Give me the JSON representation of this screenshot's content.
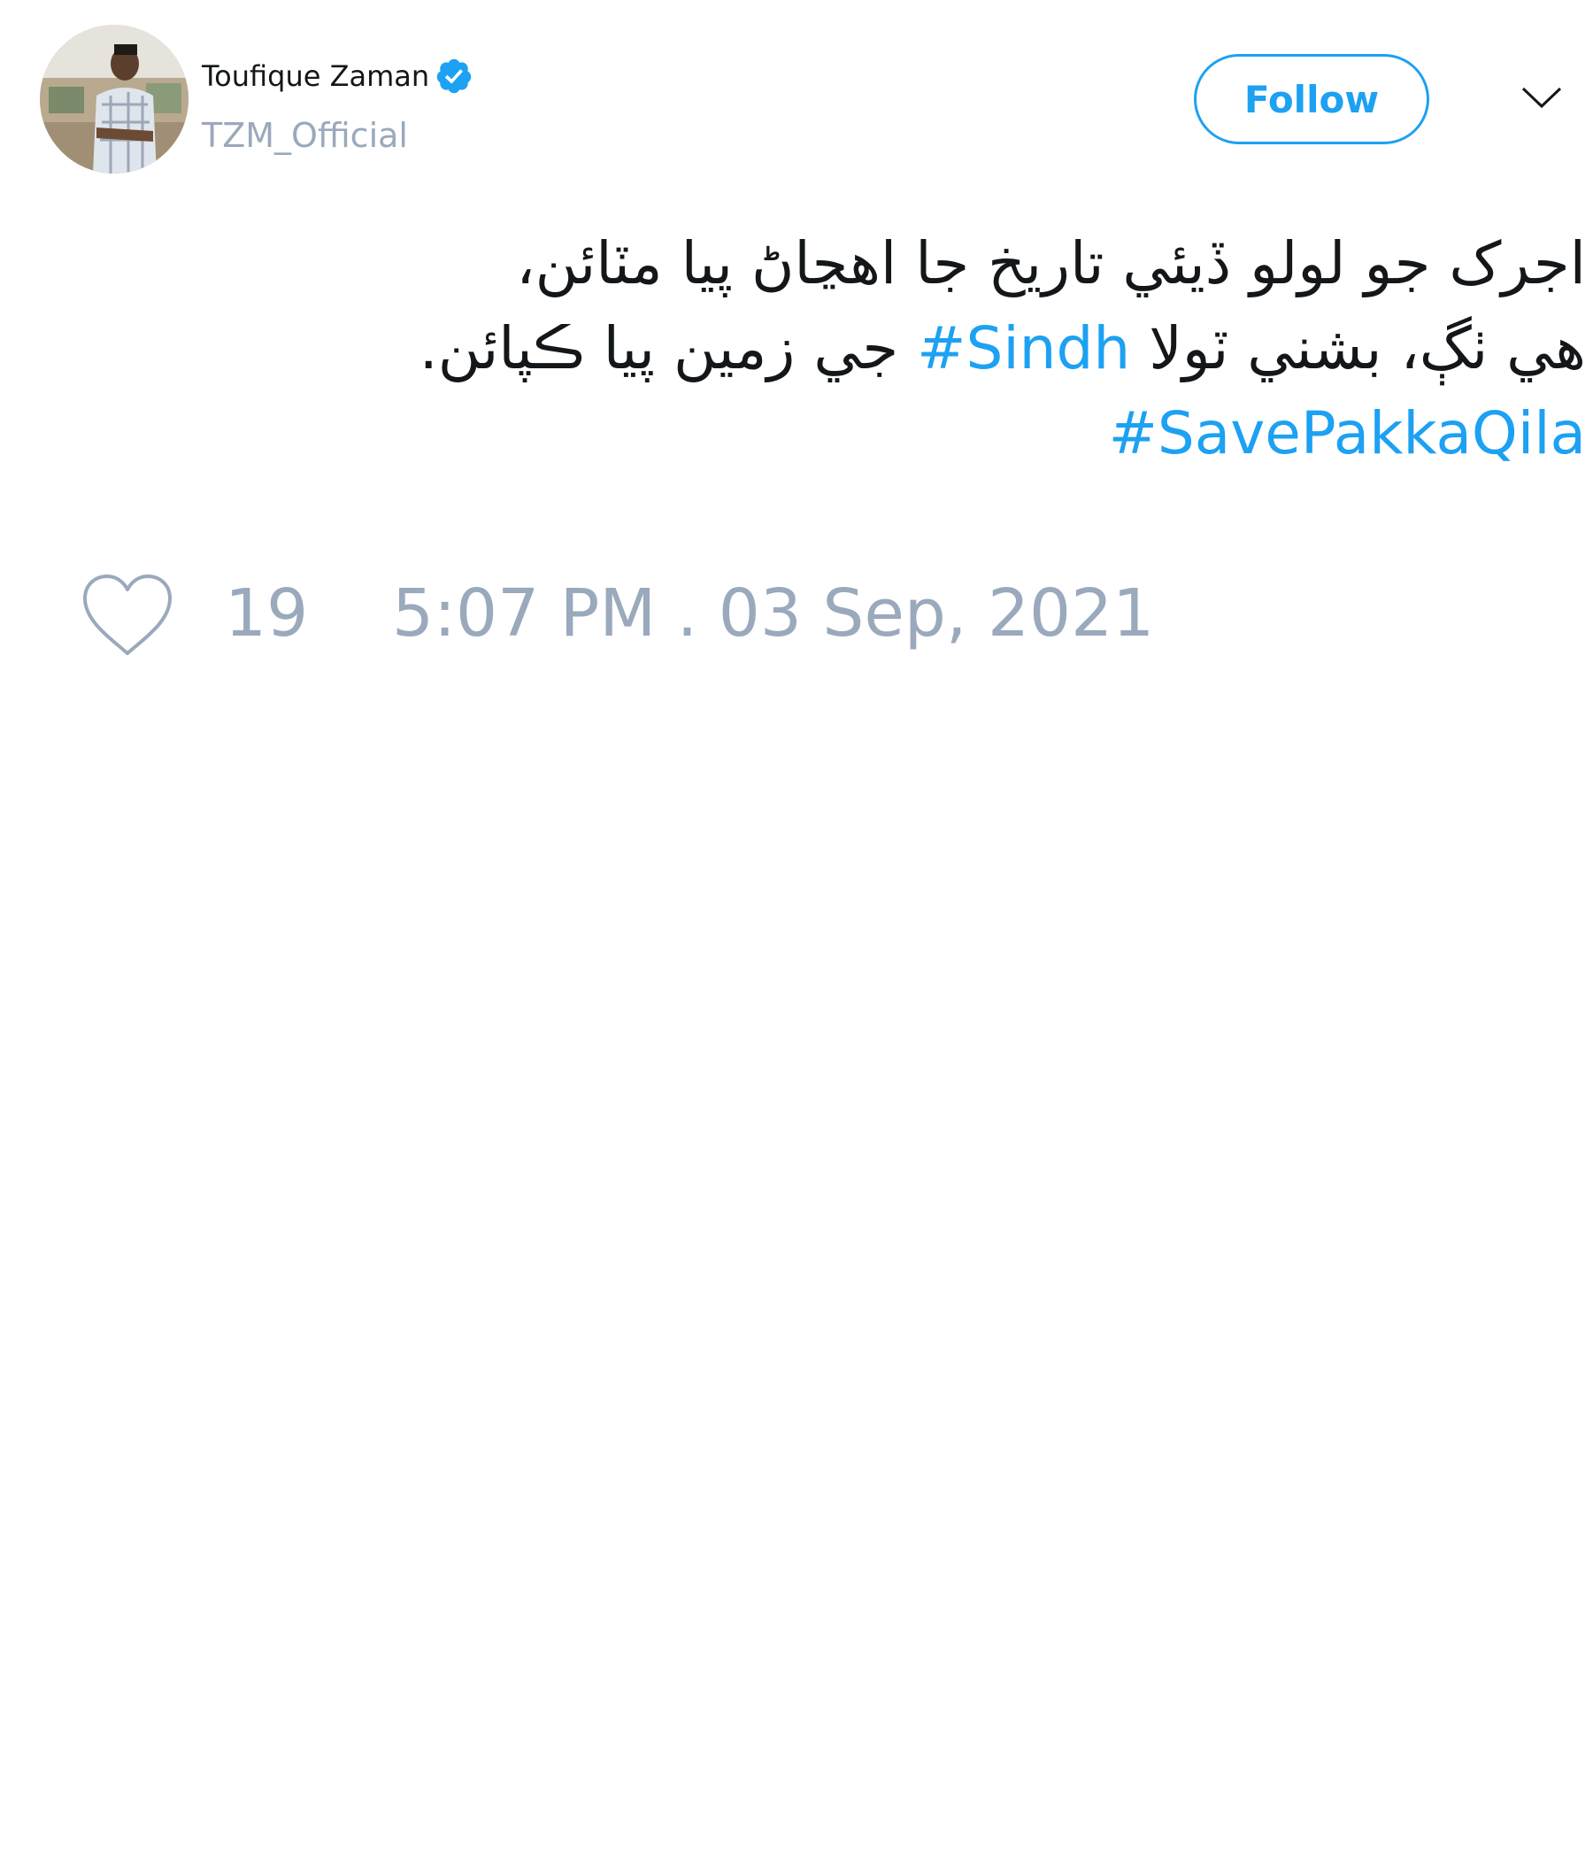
{
  "author": {
    "display_name": "Toufique Zaman",
    "verified": true,
    "handle": "TZM_Official"
  },
  "actions": {
    "follow_label": "Follow"
  },
  "tweet": {
    "lines": [
      {
        "text_before": "اجرک جو لولو ڏيئي تاريخ جا اهڃاڻ پيا مٽائن،",
        "hashtag": "",
        "text_after": ""
      },
      {
        "text_before": "هي ٺڳ، بشني ٽولا ",
        "hashtag": "#Sindh",
        "text_after": " جي زمين پيا ڪپائن."
      },
      {
        "text_before": "",
        "hashtag": "#SavePakkaQila",
        "text_after": ""
      }
    ],
    "like_count": "19",
    "timestamp": "5:07 PM . 03 Sep, 2021"
  },
  "colors": {
    "accent": "#1da1f2",
    "muted": "#9aa9bc",
    "text": "#14171a"
  }
}
